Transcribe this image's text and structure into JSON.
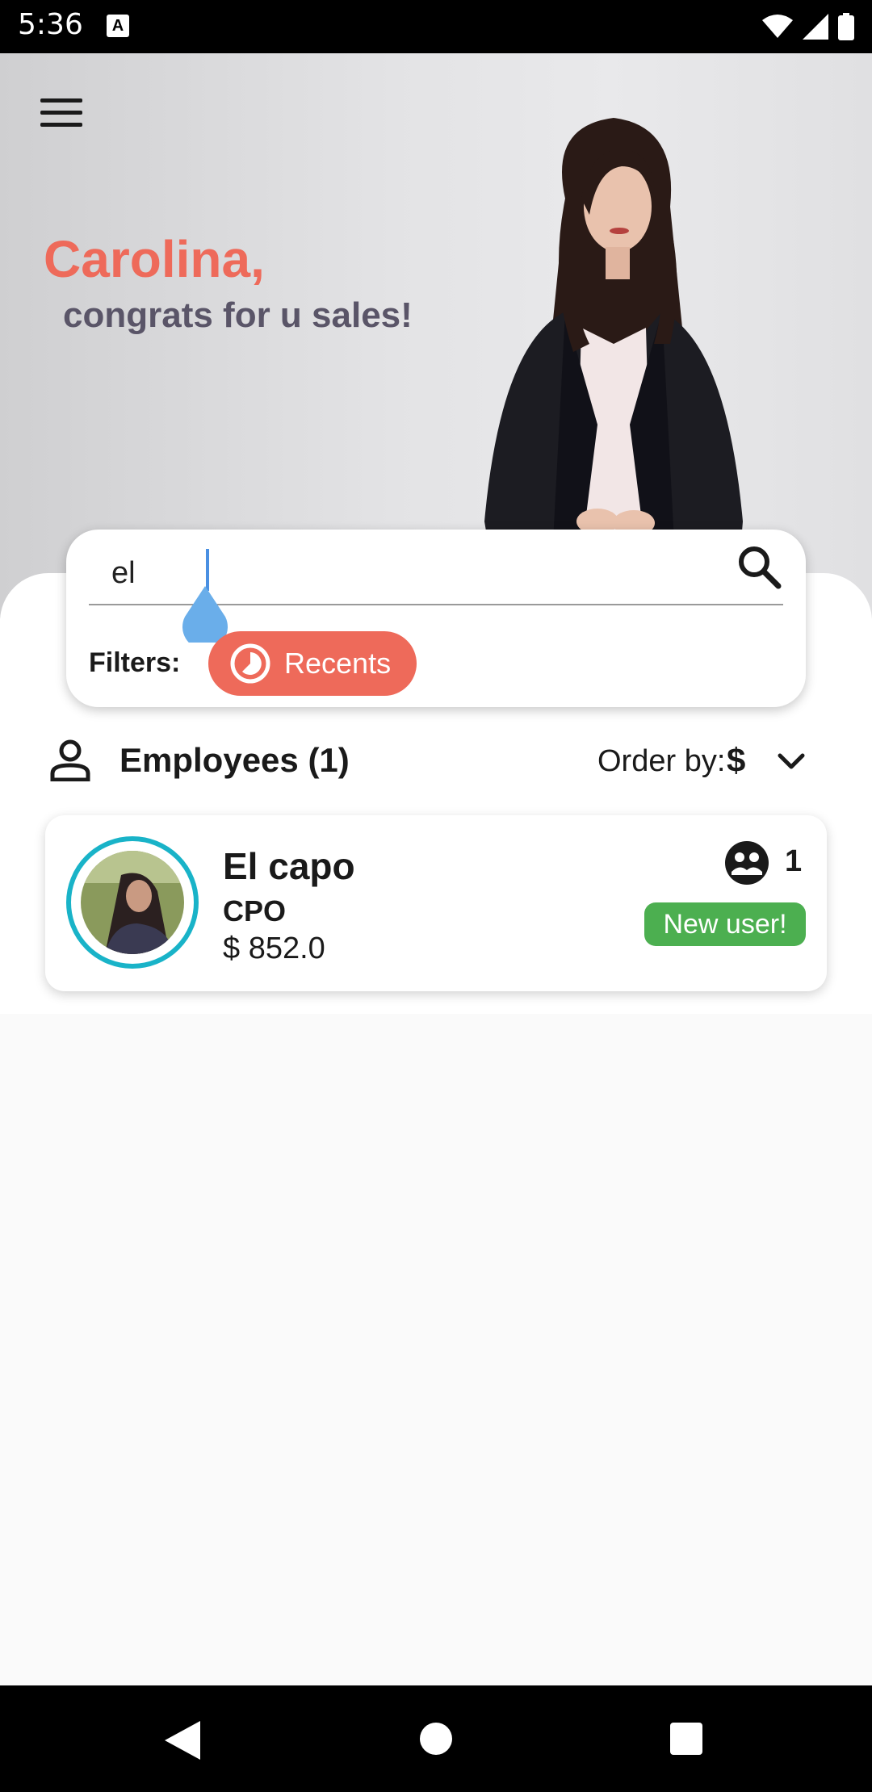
{
  "status_bar": {
    "time": "5:36",
    "notification_icon": "A"
  },
  "hero": {
    "menu_icon": "hamburger-menu-icon",
    "greeting_name": "Carolina,",
    "greeting_message": "congrats for u sales!"
  },
  "search": {
    "value": "el",
    "placeholder": "",
    "filters_label": "Filters:",
    "chip_label": "Recents",
    "chip_icon": "clock-icon"
  },
  "employees": {
    "title": "Employees (1)",
    "order_label": "Order by:",
    "order_value": "$",
    "items": [
      {
        "name": "El capo",
        "role": "CPO",
        "amount": "$ 852.0",
        "group_count": "1",
        "badge": "New user!"
      }
    ]
  },
  "colors": {
    "accent": "#ee6a5a",
    "subtitle": "#5a5568",
    "avatar_ring": "#19b3c8",
    "badge": "#4caf50"
  }
}
